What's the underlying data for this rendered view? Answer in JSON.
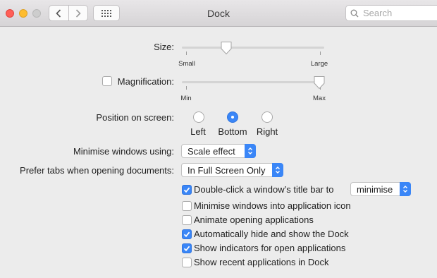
{
  "window": {
    "title": "Dock",
    "search_placeholder": "Search"
  },
  "size": {
    "label": "Size:",
    "min_label": "Small",
    "max_label": "Large",
    "value_fraction": 0.3
  },
  "magnification": {
    "label": "Magnification:",
    "checked": false,
    "min_label": "Min",
    "max_label": "Max",
    "value_fraction": 1.0
  },
  "position": {
    "label": "Position on screen:",
    "options": [
      "Left",
      "Bottom",
      "Right"
    ],
    "selected": "Bottom"
  },
  "minimise": {
    "label": "Minimise windows using:",
    "value": "Scale effect"
  },
  "tabs": {
    "label": "Prefer tabs when opening documents:",
    "value": "In Full Screen Only"
  },
  "checkboxes": [
    {
      "label": "Double-click a window’s title bar to",
      "checked": true
    },
    {
      "label": "Minimise windows into application icon",
      "checked": false
    },
    {
      "label": "Animate opening applications",
      "checked": false
    },
    {
      "label": "Automatically hide and show the Dock",
      "checked": true
    },
    {
      "label": "Show indicators for open applications",
      "checked": true
    },
    {
      "label": "Show recent applications in Dock",
      "checked": false
    }
  ],
  "double_click_action": {
    "value": "minimise"
  },
  "colors": {
    "accent": "#3a86f7",
    "close": "#ff5f57",
    "minimize": "#febc2e",
    "window_bg": "#ececec"
  },
  "icons": [
    "chevron-left-icon",
    "chevron-right-icon",
    "grid-icon",
    "search-icon",
    "checkmark-icon",
    "popup-arrows-icon"
  ]
}
